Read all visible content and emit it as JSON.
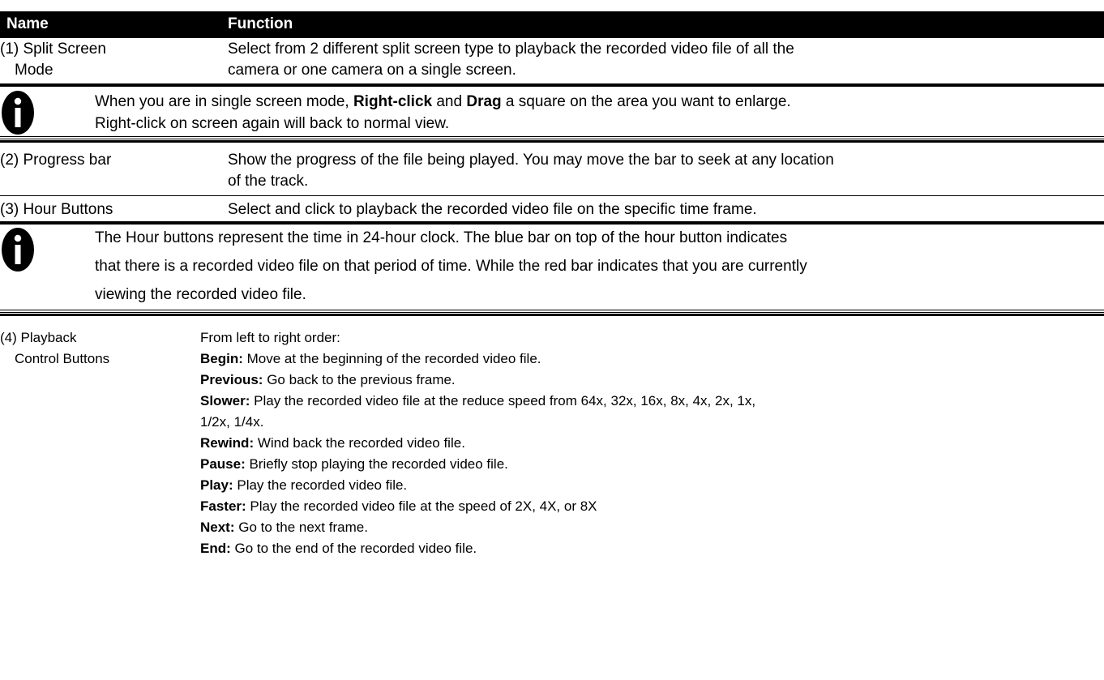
{
  "table": {
    "headers": {
      "name": "Name",
      "function": "Function"
    },
    "row1": {
      "name_line1": "(1) Split Screen",
      "name_line2": "Mode",
      "desc_line1": "Select from 2 different split screen type to playback the recorded video file of all the",
      "desc_line2": "camera or one camera on a single screen."
    },
    "note1": {
      "t1": "When you are in single screen mode, ",
      "b1": "Right-click",
      "t2": " and ",
      "b2": "Drag",
      "t3": " a square on the area you want to enlarge.",
      "line2": "Right-click on screen again will back to normal view."
    },
    "row2": {
      "name": "(2) Progress bar",
      "desc_line1": "Show the progress of the file being played. You may move the bar to seek at any location",
      "desc_line2": "of the track."
    },
    "row3": {
      "name": "(3) Hour Buttons",
      "desc": "Select and click to playback the recorded video file on the specific time frame."
    },
    "note2": {
      "line1": "The Hour buttons represent the time in 24-hour clock. The blue bar on top of the hour button indicates",
      "line2": "that there is a recorded video file on that period of time. While the red bar indicates that you are currently",
      "line3": "viewing the recorded video file."
    },
    "row4": {
      "name_line1": "(4) Playback",
      "name_line2": "Control Buttons",
      "intro": "From left to right order:",
      "items": [
        {
          "label": "Begin:",
          "text": " Move at the beginning of the recorded video file."
        },
        {
          "label": "Previous:",
          "text": " Go back to the previous frame."
        },
        {
          "label": "Slower:",
          "text": " Play the recorded video file at the reduce speed from 64x, 32x, 16x, 8x, 4x, 2x, 1x,",
          "text2": "1/2x, 1/4x."
        },
        {
          "label": "Rewind:",
          "text": " Wind back the recorded video file."
        },
        {
          "label": "Pause:",
          "text": " Briefly stop playing the recorded video file."
        },
        {
          "label": "Play:",
          "text": " Play the recorded video file."
        },
        {
          "label": "Faster:",
          "text": " Play the recorded video file at the speed of 2X, 4X, or 8X"
        },
        {
          "label": "Next:",
          "text": " Go to the next frame."
        },
        {
          "label": "End:",
          "text": " Go to the end of the recorded video file."
        }
      ]
    }
  },
  "icons": {
    "note": "info-icon"
  }
}
